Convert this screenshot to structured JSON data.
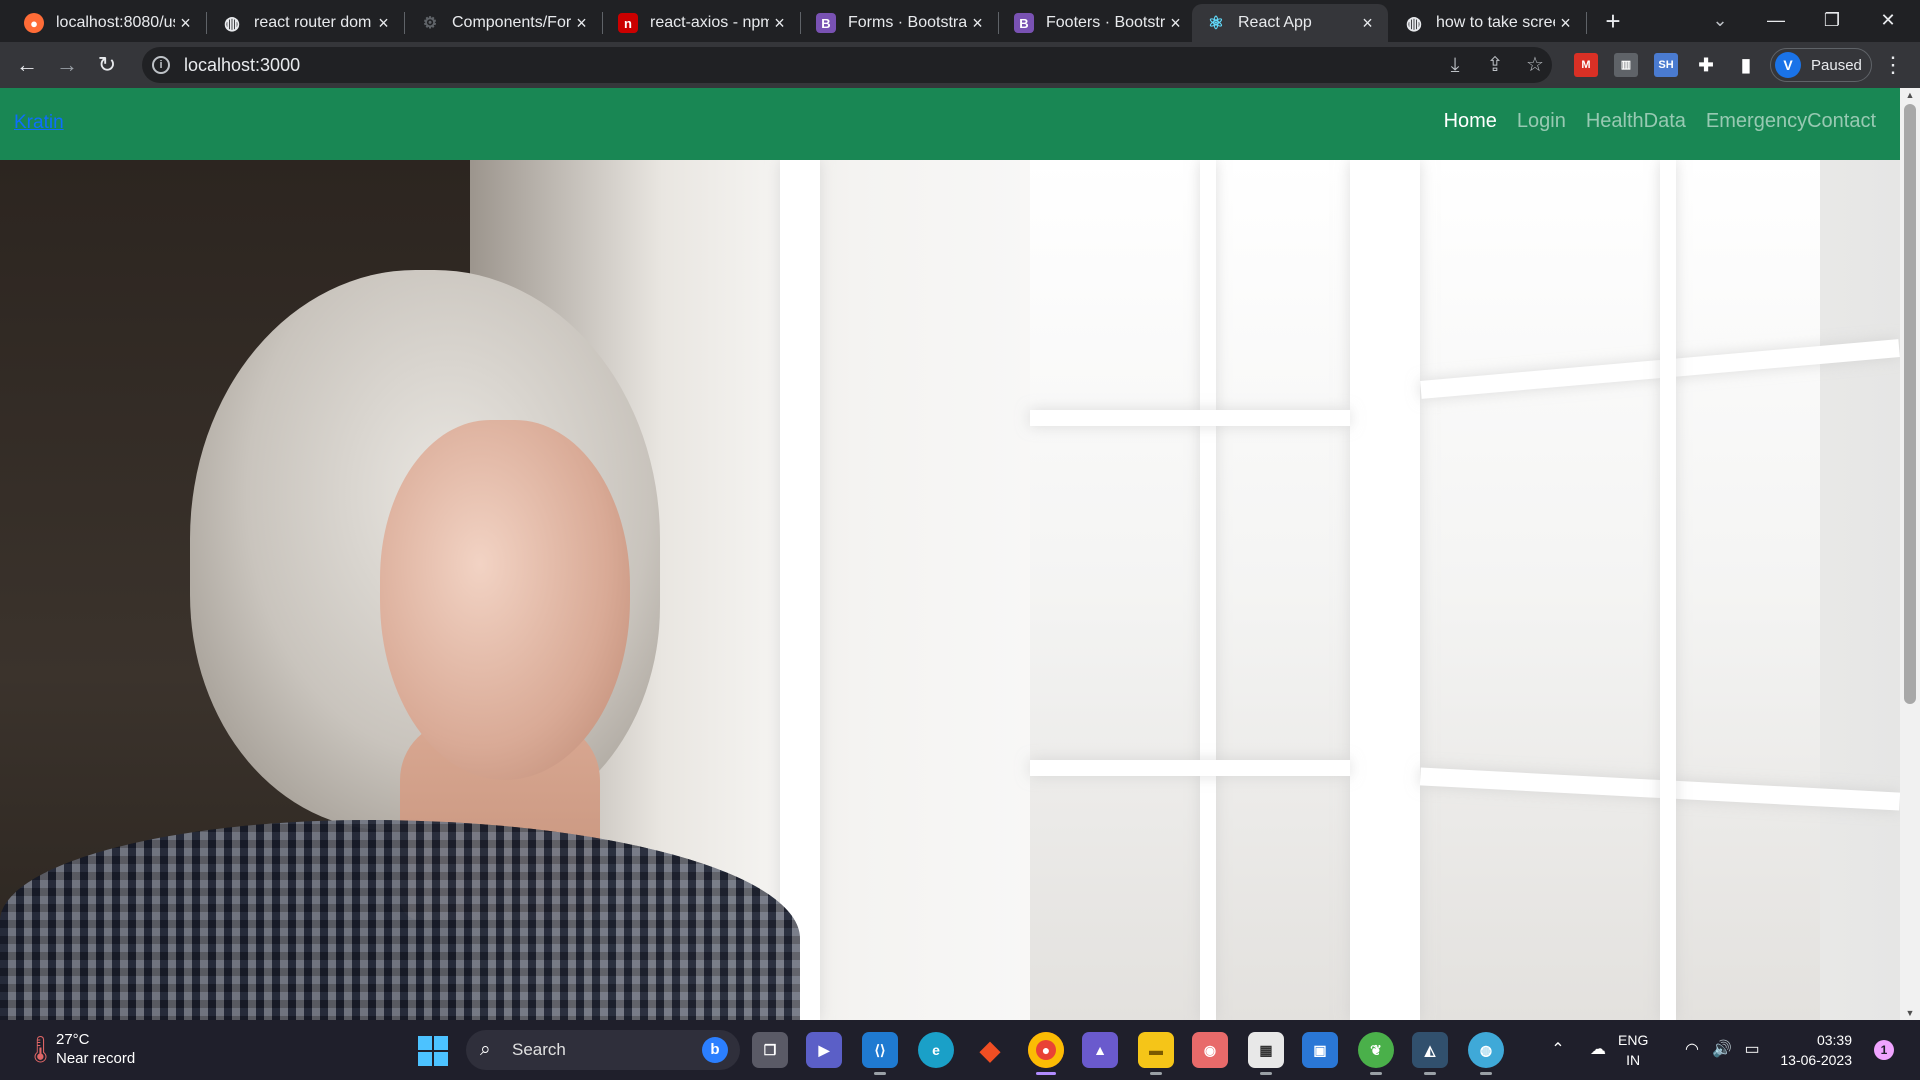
{
  "browser": {
    "tabs": [
      {
        "title": "localhost:8080/us",
        "favicon": "postman-icon",
        "color": "#ff6c37",
        "glyph": "●"
      },
      {
        "title": "react router dom",
        "favicon": "globe-icon",
        "color": "#e8eaed",
        "glyph": "◍"
      },
      {
        "title": "Components/For",
        "favicon": "storybook-icon",
        "color": "#5f6368",
        "glyph": "⚙"
      },
      {
        "title": "react-axios - npm",
        "favicon": "npm-icon",
        "color": "#cb0000",
        "glyph": "n"
      },
      {
        "title": "Forms · Bootstrap",
        "favicon": "bootstrap-icon",
        "color": "#7952b3",
        "glyph": "B"
      },
      {
        "title": "Footers · Bootstra",
        "favicon": "bootstrap-icon",
        "color": "#7952b3",
        "glyph": "B"
      },
      {
        "title": "React App",
        "favicon": "react-icon",
        "color": "#35363a",
        "glyph": "⚛",
        "active": true
      },
      {
        "title": "how to take scree",
        "favicon": "globe-icon",
        "color": "#e8eaed",
        "glyph": "◍"
      }
    ],
    "url": "localhost:3000",
    "profile_initial": "V",
    "profile_status": "Paused"
  },
  "page": {
    "brand": "Kratin",
    "nav": [
      "Home",
      "Login",
      "HealthData",
      "EmergencyContact"
    ],
    "active_nav": "Home",
    "navbar_color": "#198754",
    "hero_image": "elderly woman looking out of window"
  },
  "taskbar": {
    "weather_temp": "27°C",
    "weather_desc": "Near record",
    "search_placeholder": "Search",
    "language": "ENG",
    "region": "IN",
    "time": "03:39",
    "date": "13-06-2023",
    "notification_count": "1"
  }
}
